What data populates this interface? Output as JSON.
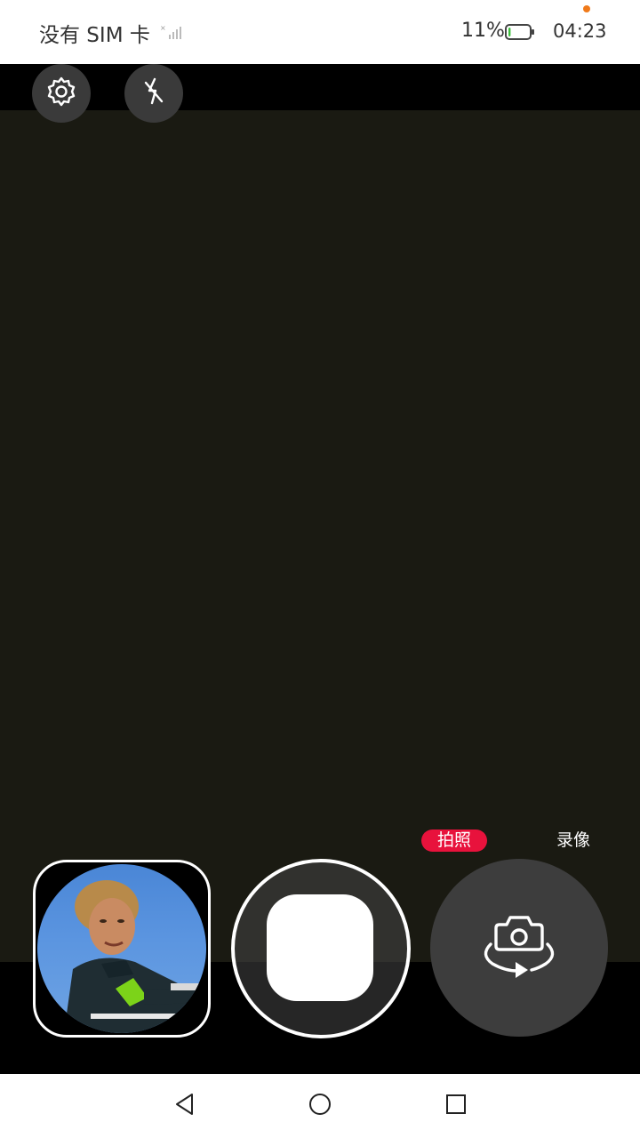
{
  "status_bar": {
    "carrier": "没有 SIM 卡",
    "battery_percent": "11%",
    "battery_level": 0.11,
    "time": "04:23",
    "icons": [
      "signal-icon",
      "battery-icon",
      "notification-dot"
    ]
  },
  "camera": {
    "top_icons": [
      "gear-icon",
      "flash-off-icon"
    ],
    "modes": {
      "photo": "拍照",
      "video": "录像",
      "active": "photo"
    },
    "controls": [
      "gallery-thumbnail",
      "shutter-button",
      "switch-camera-icon"
    ]
  },
  "nav_bar": {
    "icons": [
      "back-triangle-icon",
      "home-circle-icon",
      "recent-square-icon"
    ]
  },
  "colors": {
    "accent": "#e8123c",
    "viewfinder": "#1a1a12",
    "control_bg": "#3d3d3d"
  }
}
